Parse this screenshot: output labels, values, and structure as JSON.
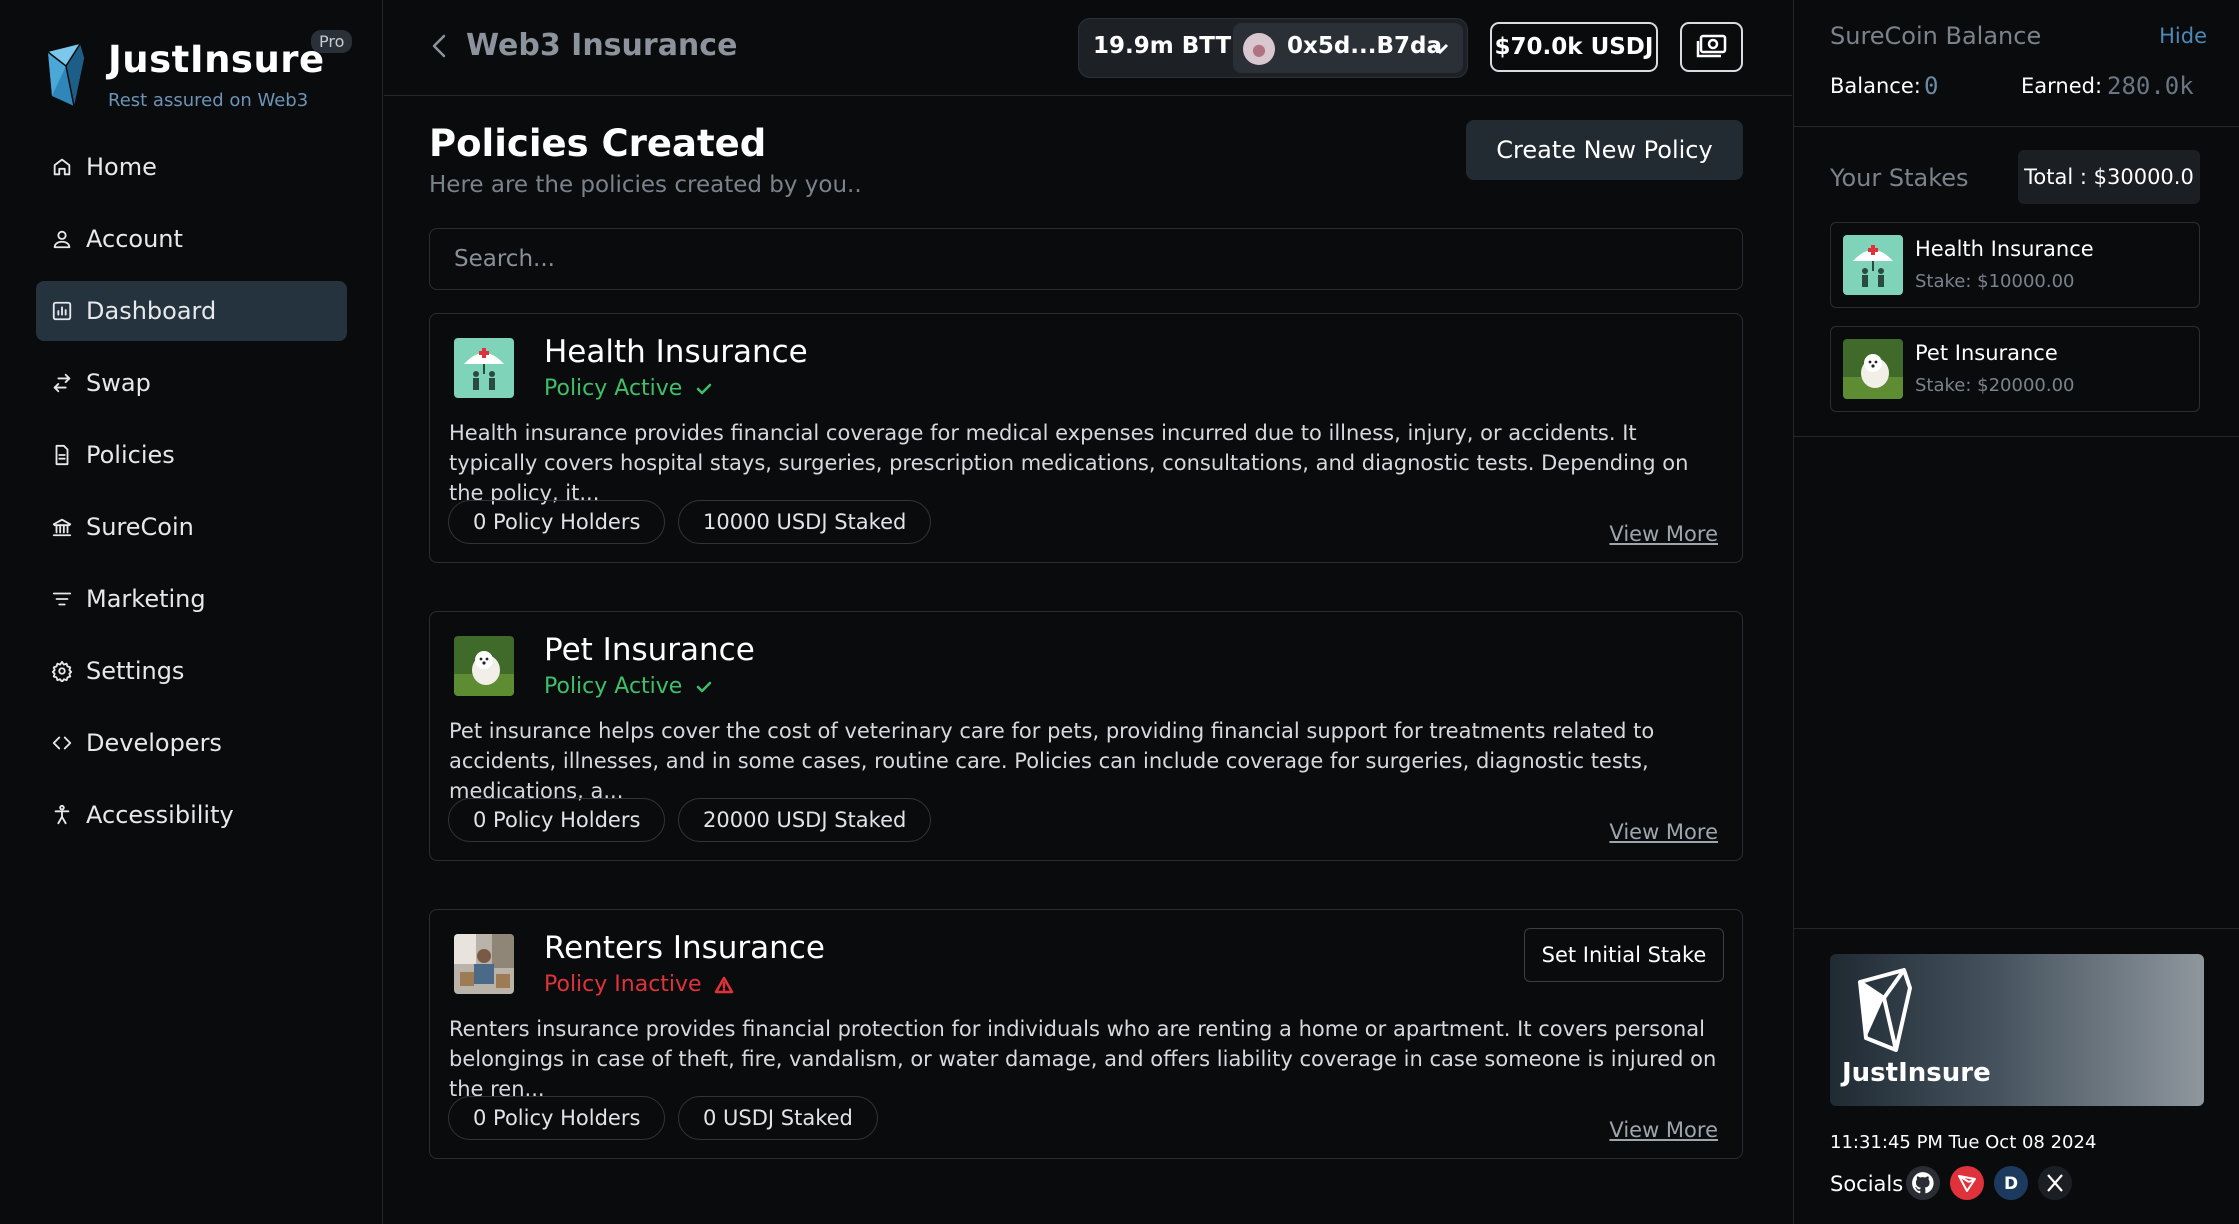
{
  "brand": {
    "name": "JustInsure",
    "badge": "Pro",
    "tagline": "Rest assured on Web3"
  },
  "sidebar": {
    "items": [
      {
        "label": "Home",
        "icon": "home-icon",
        "active": false
      },
      {
        "label": "Account",
        "icon": "user-icon",
        "active": false
      },
      {
        "label": "Dashboard",
        "icon": "chart-icon",
        "active": true
      },
      {
        "label": "Swap",
        "icon": "swap-icon",
        "active": false
      },
      {
        "label": "Policies",
        "icon": "document-icon",
        "active": false
      },
      {
        "label": "SureCoin",
        "icon": "bank-icon",
        "active": false
      },
      {
        "label": "Marketing",
        "icon": "filter-icon",
        "active": false
      },
      {
        "label": "Settings",
        "icon": "gear-icon",
        "active": false
      },
      {
        "label": "Developers",
        "icon": "code-icon",
        "active": false
      },
      {
        "label": "Accessibility",
        "icon": "accessibility-icon",
        "active": false
      }
    ]
  },
  "header": {
    "title": "Web3 Insurance",
    "btt_balance": "19.9m BTT",
    "wallet_address": "0x5d...B7da",
    "usdj_balance": "$70.0k USDJ"
  },
  "main": {
    "title": "Policies Created",
    "subtitle": "Here are the policies created by you..",
    "create_label": "Create New Policy",
    "search_placeholder": "Search...",
    "policies": [
      {
        "title": "Health Insurance",
        "status": "Policy Active",
        "active": true,
        "description": "Health insurance provides financial coverage for medical expenses incurred due to illness, injury, or accidents. It typically covers hospital stays, surgeries, prescription medications, consultations, and diagnostic tests. Depending on the policy, it...",
        "holders": "0 Policy Holders",
        "staked": "10000 USDJ Staked",
        "view_more": "View More"
      },
      {
        "title": "Pet Insurance",
        "status": "Policy Active",
        "active": true,
        "description": "Pet insurance helps cover the cost of veterinary care for pets, providing financial support for treatments related to accidents, illnesses, and in some cases, routine care. Policies can include coverage for surgeries, diagnostic tests, medications, a...",
        "holders": "0 Policy Holders",
        "staked": "20000 USDJ Staked",
        "view_more": "View More"
      },
      {
        "title": "Renters Insurance",
        "status": "Policy Inactive",
        "active": false,
        "description": "Renters insurance provides financial protection for individuals who are renting a home or apartment. It covers personal belongings in case of theft, fire, vandalism, or water damage, and offers liability coverage in case someone is injured on the ren...",
        "holders": "0 Policy Holders",
        "staked": "0 USDJ Staked",
        "view_more": "View More",
        "action_label": "Set Initial Stake"
      }
    ]
  },
  "right_panel": {
    "heading": "SureCoin Balance",
    "hide_label": "Hide",
    "balance_label": "Balance:",
    "balance_value": "0",
    "earned_label": "Earned:",
    "earned_value": "280.0k",
    "stakes_heading": "Your Stakes",
    "total_label": "Total : $30000.0",
    "stakes": [
      {
        "name": "Health Insurance",
        "amount": "Stake: $10000.00"
      },
      {
        "name": "Pet Insurance",
        "amount": "Stake: $20000.00"
      }
    ],
    "promo_name": "JustInsure",
    "datetime": "11:31:45 PM   Tue Oct 08 2024",
    "socials_label": "Socials",
    "social_icons": [
      "github-icon",
      "tron-icon",
      "d-icon",
      "x-icon"
    ]
  },
  "colors": {
    "accent_active_bg": "#24333d",
    "status_active": "#3fbf6a",
    "status_inactive": "#e0323a",
    "link_blue": "#4d88b8"
  }
}
